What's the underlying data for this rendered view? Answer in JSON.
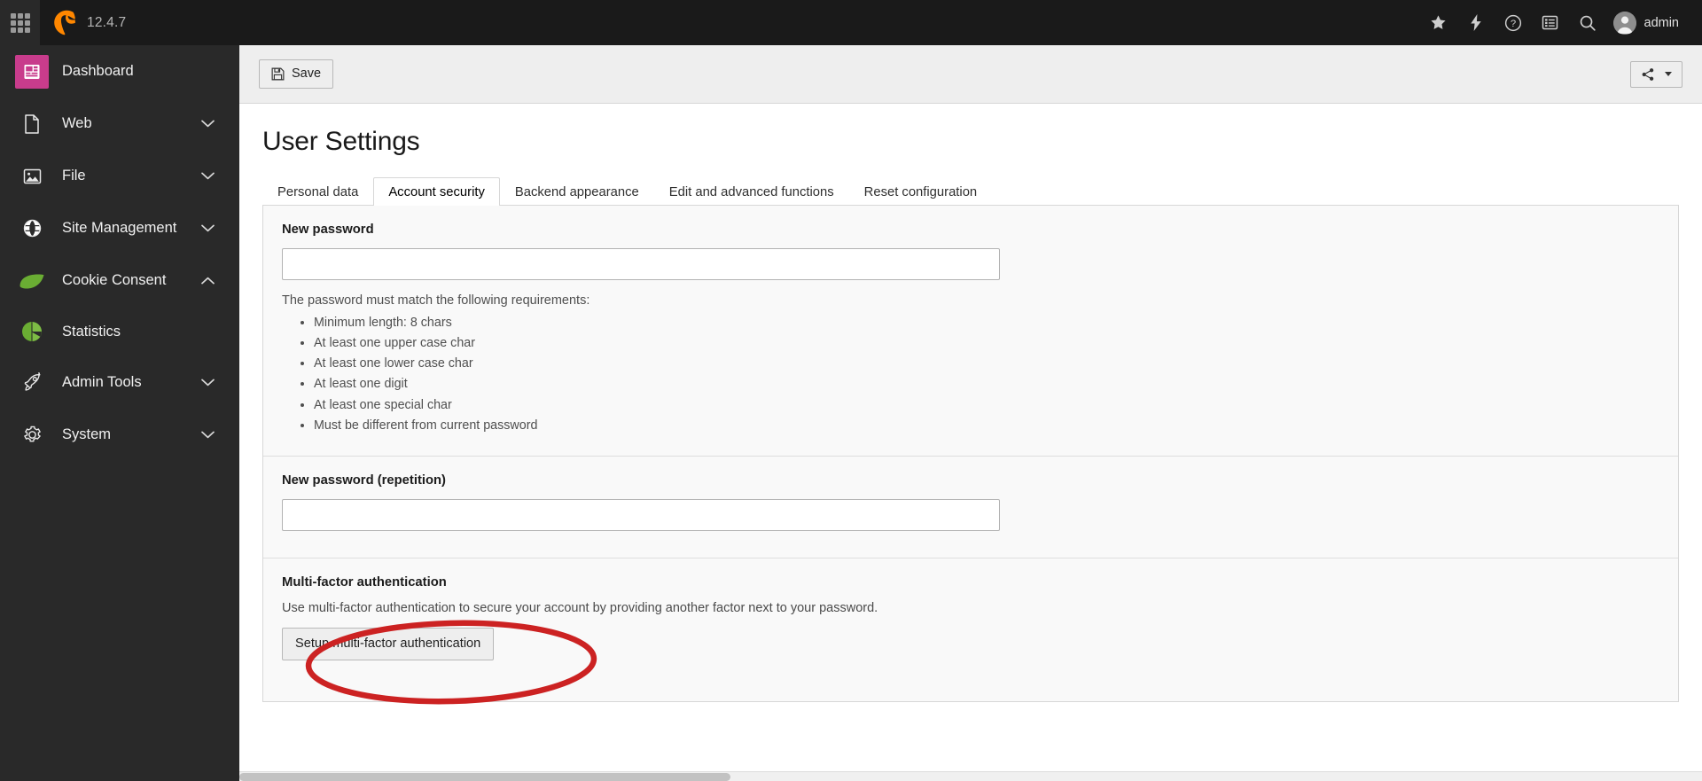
{
  "topbar": {
    "module_menu_icon": "grid-icon",
    "logo_icon": "typo3-logo-icon",
    "version": "12.4.7",
    "items": [
      {
        "name": "bookmarks",
        "icon": "star-icon"
      },
      {
        "name": "clear-cache",
        "icon": "lightning-bolt-icon"
      },
      {
        "name": "help",
        "icon": "question-circle-icon"
      },
      {
        "name": "workspaces",
        "icon": "list-clipboard-icon"
      },
      {
        "name": "search",
        "icon": "search-icon"
      }
    ],
    "user": {
      "name": "admin",
      "avatar_icon": "user-avatar-icon"
    }
  },
  "sidebar": {
    "items": [
      {
        "label": "Dashboard",
        "icon": "dashboard-icon",
        "active": true,
        "expandable": false,
        "color": "#c83c8c"
      },
      {
        "label": "Web",
        "icon": "page-document-icon",
        "expandable": true,
        "expanded": false
      },
      {
        "label": "File",
        "icon": "image-file-icon",
        "expandable": true,
        "expanded": false
      },
      {
        "label": "Site Management",
        "icon": "globe-icon",
        "expandable": true,
        "expanded": false
      },
      {
        "label": "Cookie Consent",
        "icon": "leaf-icon",
        "expandable": true,
        "expanded": true,
        "color": "#6aad33"
      },
      {
        "label": "Statistics",
        "icon": "pie-chart-icon",
        "sub": true,
        "color": "#6aad33"
      },
      {
        "label": "Admin Tools",
        "icon": "rocket-icon",
        "expandable": true,
        "expanded": false
      },
      {
        "label": "System",
        "icon": "gear-icon",
        "expandable": true,
        "expanded": false
      }
    ]
  },
  "docheader": {
    "save_label": "Save",
    "save_icon": "floppy-disk-icon",
    "share_icon": "share-nodes-icon",
    "share_caret_icon": "caret-down-icon"
  },
  "page": {
    "title": "User Settings"
  },
  "tabs": [
    {
      "label": "Personal data",
      "active": false
    },
    {
      "label": "Account security",
      "active": true
    },
    {
      "label": "Backend appearance",
      "active": false
    },
    {
      "label": "Edit and advanced functions",
      "active": false
    },
    {
      "label": "Reset configuration",
      "active": false
    }
  ],
  "form": {
    "new_password": {
      "label": "New password",
      "value": "",
      "placeholder": "",
      "help": "The password must match the following requirements:",
      "requirements": [
        "Minimum length: 8 chars",
        "At least one upper case char",
        "At least one lower case char",
        "At least one digit",
        "At least one special char",
        "Must be different from current password"
      ]
    },
    "new_password_repeat": {
      "label": "New password (repetition)",
      "value": "",
      "placeholder": ""
    },
    "mfa": {
      "label": "Multi-factor authentication",
      "description": "Use multi-factor authentication to secure your account by providing another factor next to your password.",
      "setup_button": "Setup multi-factor authentication"
    }
  },
  "annotation": {
    "shape": "ellipse",
    "color": "#cc2222",
    "target": "setup-mfa-button"
  }
}
